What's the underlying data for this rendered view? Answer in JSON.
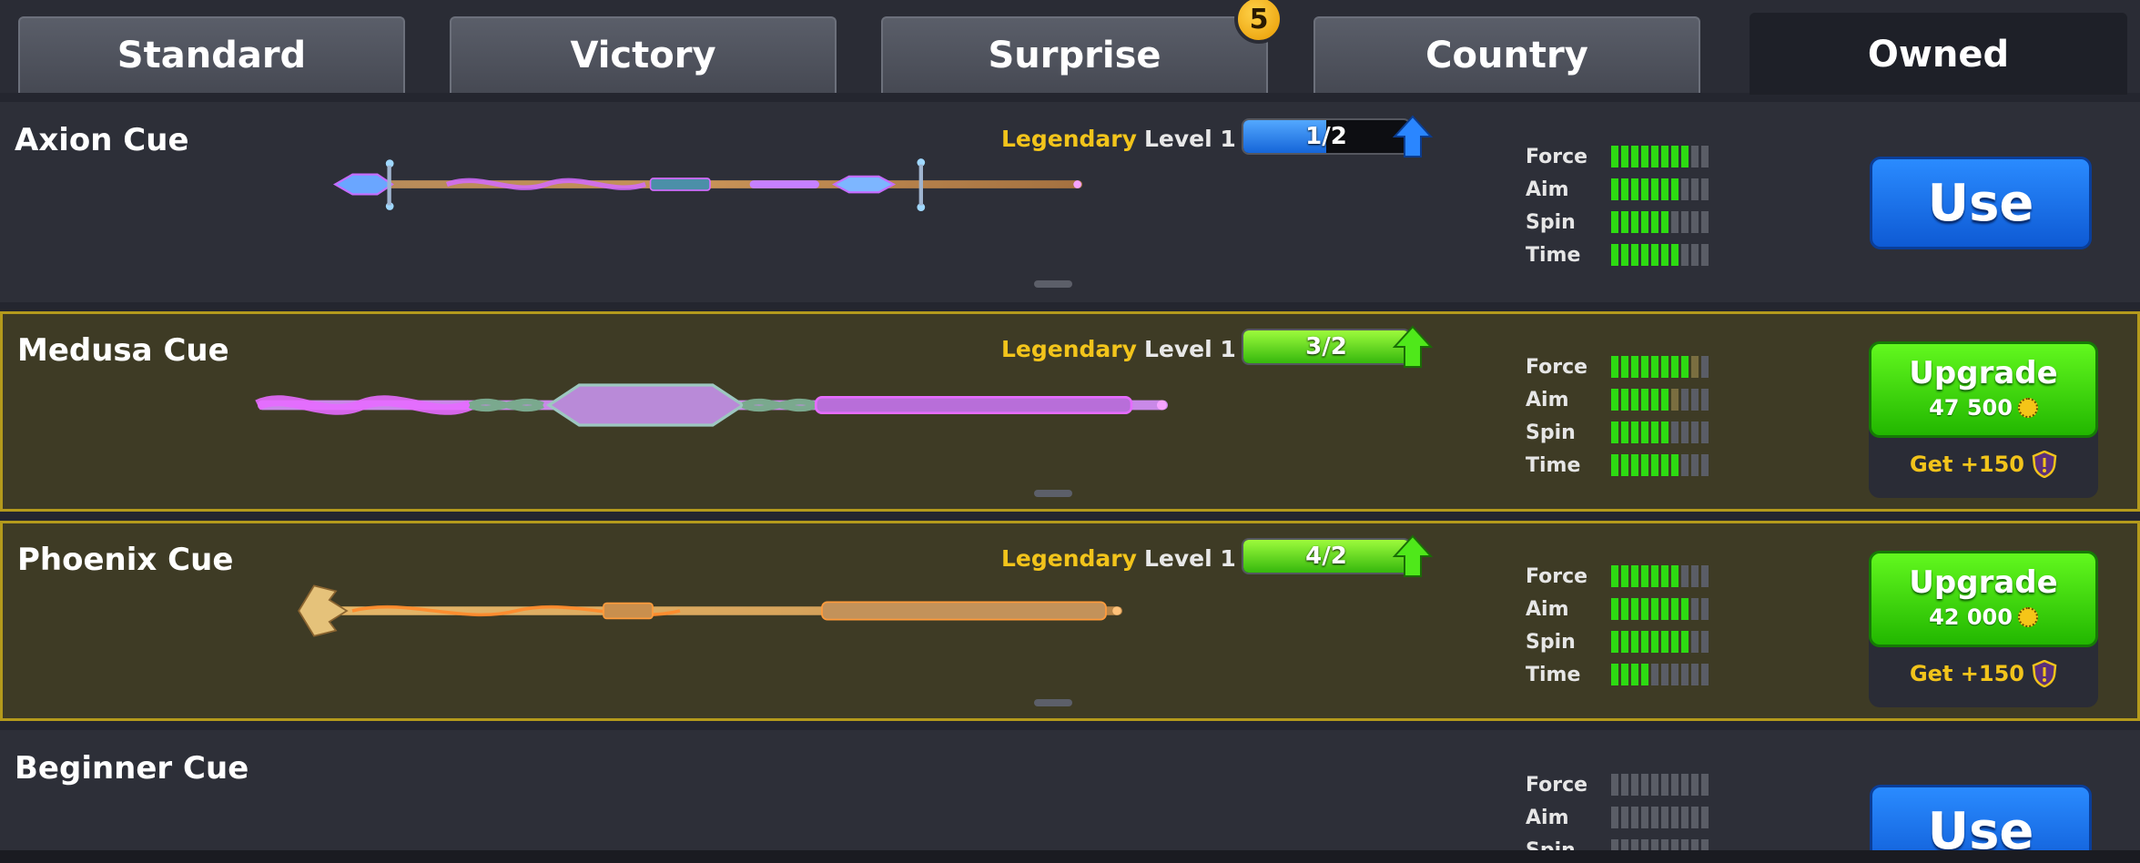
{
  "tabs": [
    {
      "label": "Standard"
    },
    {
      "label": "Victory"
    },
    {
      "label": "Surprise",
      "badge": "5"
    },
    {
      "label": "Country"
    },
    {
      "label": "Owned",
      "active": true
    }
  ],
  "stat_labels": {
    "force": "Force",
    "aim": "Aim",
    "spin": "Spin",
    "time": "Time"
  },
  "cues": [
    {
      "name": "Axion Cue",
      "rarity": "Legendary",
      "level": "Level 1",
      "progress_text": "1/2",
      "progress_fraction": 0.5,
      "progress_color": "#2a86ff",
      "stats": {
        "force": 8,
        "aim": 7,
        "spin": 6,
        "time": 7
      },
      "action": "Use"
    },
    {
      "name": "Medusa Cue",
      "rarity": "Legendary",
      "level": "Level 1",
      "progress_text": "3/2",
      "progress_fraction": 1.0,
      "progress_color": "#4fe81a",
      "stats": {
        "force": 8,
        "aim": 6,
        "spin": 6,
        "time": 7
      },
      "action": "Upgrade",
      "price": "47 500",
      "bonus": "Get +150"
    },
    {
      "name": "Phoenix Cue",
      "rarity": "Legendary",
      "level": "Level 1",
      "progress_text": "4/2",
      "progress_fraction": 1.0,
      "progress_color": "#4fe81a",
      "stats": {
        "force": 7,
        "aim": 8,
        "spin": 8,
        "time": 4
      },
      "action": "Upgrade",
      "price": "42 000",
      "bonus": "Get +150"
    },
    {
      "name": "Beginner Cue",
      "stats": {
        "force": 0,
        "aim": 0,
        "spin": 0,
        "time": 0
      },
      "action": "Use"
    }
  ],
  "colors": {
    "legendary": "#f2c41b",
    "stat_on": "#2ddb12",
    "stat_off": "#5a5d66",
    "use_button": "#1a73f0",
    "upgrade_button": "#3fd60e"
  }
}
